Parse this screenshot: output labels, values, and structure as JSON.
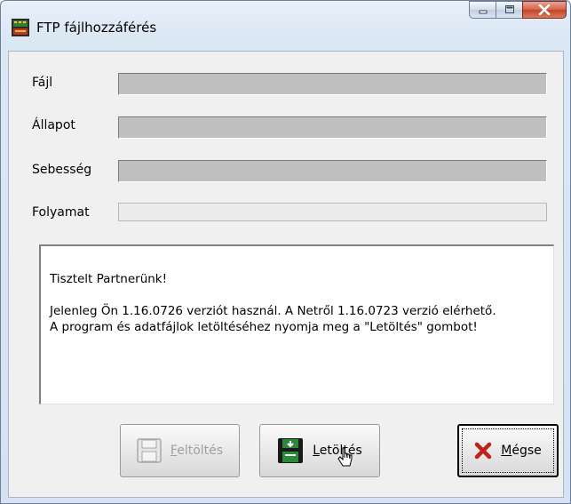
{
  "window": {
    "title": "FTP fájlhozzáférés",
    "controls": [
      "minimize-icon",
      "maximize-icon",
      "close-icon"
    ]
  },
  "fields": [
    {
      "label": "Fájl",
      "value": ""
    },
    {
      "label": "Állapot",
      "value": ""
    },
    {
      "label": "Sebesség",
      "value": ""
    }
  ],
  "progress": {
    "label": "Folyamat",
    "value_percent": 0
  },
  "message": {
    "greeting": "Tisztelt Partnerünk!",
    "line1": "Jelenleg Ön 1.16.0726 verziót használ. A Netről 1.16.0723 verzió elérhető.",
    "line2": "A program és adatfájlok letöltéséhez nyomja meg a \"Letöltés\" gombot!"
  },
  "buttons": {
    "upload": {
      "label": "Feltöltés",
      "enabled": false,
      "icon": "floppy-upload-icon"
    },
    "download": {
      "label": "Letöltés",
      "enabled": true,
      "icon": "floppy-download-icon"
    },
    "cancel": {
      "label": "Mégse",
      "enabled": true,
      "icon": "red-x-icon"
    }
  },
  "colors": {
    "field_disabled": "#c0c0c0",
    "cancel_x": "#c0221b",
    "floppy_green": "#2a8a3a"
  }
}
